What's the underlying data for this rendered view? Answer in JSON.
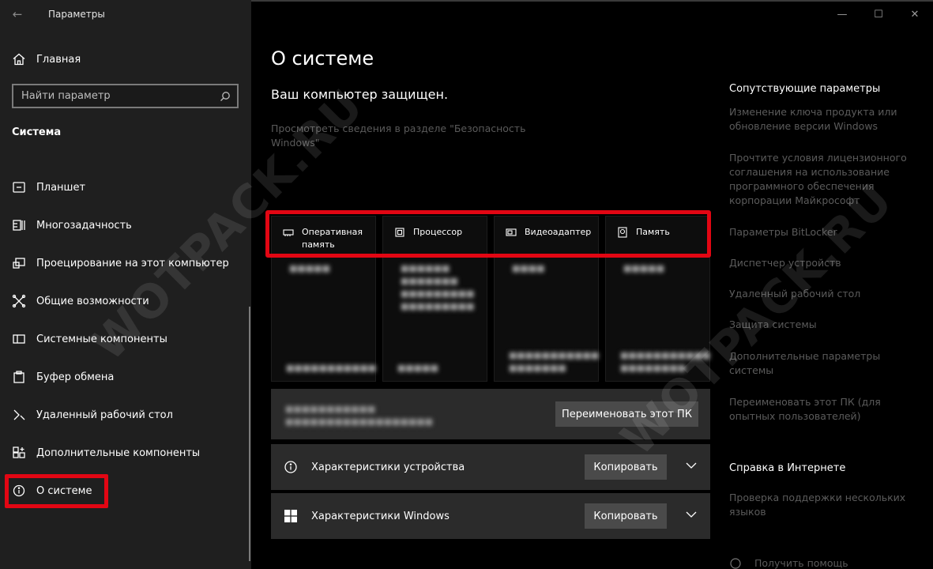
{
  "window": {
    "title": "Параметры",
    "controls": {
      "minimize": "—",
      "maximize": "☐",
      "close": "✕"
    }
  },
  "sidebar": {
    "home_label": "Главная",
    "search_placeholder": "Найти параметр",
    "section_title": "Система",
    "items": [
      {
        "label": "Планшет",
        "icon": "tablet-icon"
      },
      {
        "label": "Многозадачность",
        "icon": "multitasking-icon"
      },
      {
        "label": "Проецирование на этот компьютер",
        "icon": "projecting-icon"
      },
      {
        "label": "Общие возможности",
        "icon": "shared-experiences-icon"
      },
      {
        "label": "Системные компоненты",
        "icon": "system-components-icon"
      },
      {
        "label": "Буфер обмена",
        "icon": "clipboard-icon"
      },
      {
        "label": "Удаленный рабочий стол",
        "icon": "remote-desktop-icon"
      },
      {
        "label": "Дополнительные компоненты",
        "icon": "optional-features-icon"
      },
      {
        "label": "О системе",
        "icon": "info-icon",
        "active": true
      }
    ]
  },
  "main": {
    "title": "О системе",
    "protected": "Ваш компьютер защищен.",
    "security_link": "Просмотреть сведения в разделе \"Безопасность Windows\"",
    "specs": [
      {
        "label": "Оперативная память",
        "icon": "ram-icon"
      },
      {
        "label": "Процессор",
        "icon": "processor-icon"
      },
      {
        "label": "Видеоадаптер",
        "icon": "gpu-icon"
      },
      {
        "label": "Память",
        "icon": "storage-icon"
      }
    ],
    "rename_button": "Переименовать этот ПК",
    "device_specs": {
      "label": "Характеристики устройства",
      "copy": "Копировать"
    },
    "windows_specs": {
      "label": "Характеристики Windows",
      "copy": "Копировать"
    }
  },
  "related": {
    "title": "Сопутствующие параметры",
    "links": [
      "Изменение ключа продукта или обновление версии Windows",
      "Прочтите условия лицензионного соглашения на использование программного обеспечения корпорации Майкрософт",
      "Параметры BitLocker",
      "Диспетчер устройств",
      "Удаленный рабочий стол",
      "Защита системы",
      "Дополнительные параметры системы",
      "Переименовать этот ПК (для опытных пользователей)"
    ]
  },
  "help": {
    "title": "Справка в Интернете",
    "links": [
      "Проверка поддержки нескольких языков"
    ],
    "get_help": "Получить помощь"
  },
  "watermark": "WOTPACK.RU",
  "colors": {
    "highlight": "#e20613",
    "background": "#000000",
    "sidebar": "#1f1f1f",
    "card": "#2b2b2b"
  }
}
